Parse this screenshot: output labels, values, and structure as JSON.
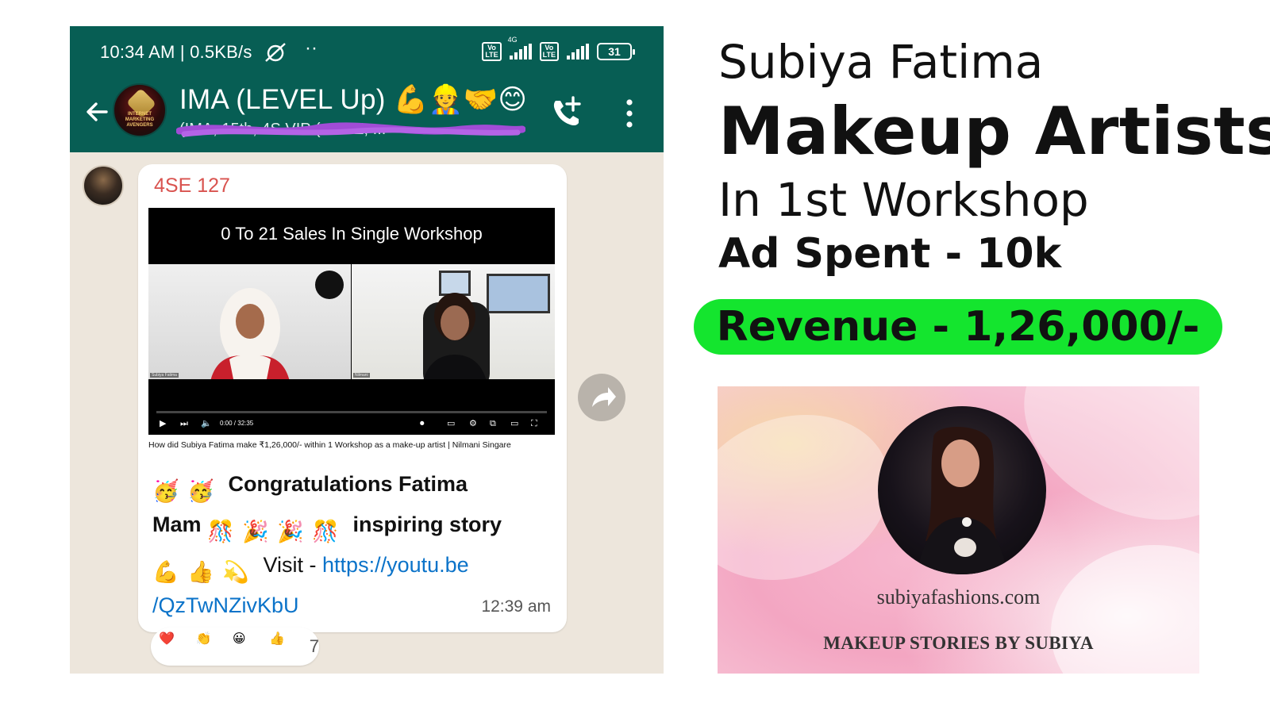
{
  "status_bar": {
    "time_speed": "10:34 AM | 0.5KB/s",
    "more": "··",
    "network_type": "4G",
    "volte_label": "Vo\nLTE",
    "battery": "31"
  },
  "chat_header": {
    "title": "IMA (LEVEL Up) 💪👷🤝😊",
    "subtitle_redacted": "(IMA, 15th, 4S VIP (+ 4SE, ...",
    "avatar_text": "INTERNET MARKETING AVENGERS",
    "icons": [
      "back-arrow-icon",
      "add-call-icon",
      "more-vert-icon"
    ]
  },
  "message": {
    "sender": "4SE 127",
    "video": {
      "title": "0 To 21 Sales In Single Workshop",
      "left_tag": "Subiya Fatima",
      "right_tag": "Nilmani",
      "time": "0:00 / 32:35"
    },
    "video_caption": "How did Subiya Fatima make ₹1,26,000/- within 1 Workshop as a make-up artist | Nilmani Singare",
    "line1_text": "Congratulations Fatima",
    "line2_start": "Mam",
    "line2_end": "inspiring story",
    "line3_text": "Visit - ",
    "link_part1": "https://youtu.be",
    "link_part2": "/QzTwNZivKbU",
    "timestamp": "12:39 am"
  },
  "reactions": {
    "emojis": [
      "❤️",
      "👏",
      "😀",
      "👍"
    ],
    "count": "7"
  },
  "headline": {
    "name": "Subiya Fatima",
    "main": "Makeup Artists",
    "sub": "In 1st Workshop",
    "ad_spent": "Ad Spent - 10k",
    "revenue": "Revenue - 1,26,000/-",
    "revenue_color": "#14e52e"
  },
  "promo": {
    "url": "subiyafashions.com",
    "tagline": "MAKEUP STORIES BY SUBIYA"
  },
  "colors": {
    "whatsapp_header": "#075e54",
    "sender_name": "#d9534f",
    "link": "#0b73c9"
  }
}
